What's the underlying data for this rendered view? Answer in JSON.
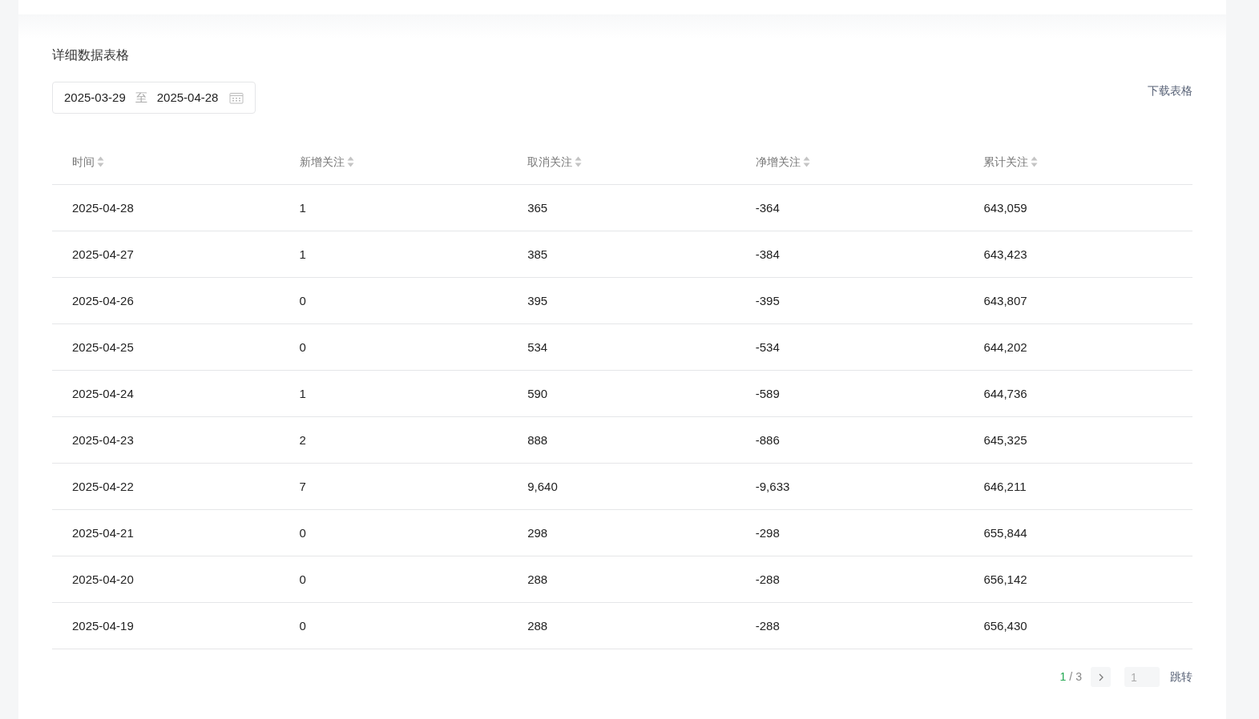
{
  "section_title": "详细数据表格",
  "date_range": {
    "start": "2025-03-29",
    "separator": "至",
    "end": "2025-04-28"
  },
  "download_link": "下载表格",
  "table": {
    "columns": [
      {
        "label": "时间",
        "sortable": true
      },
      {
        "label": "新增关注",
        "sortable": true
      },
      {
        "label": "取消关注",
        "sortable": true
      },
      {
        "label": "净增关注",
        "sortable": true
      },
      {
        "label": "累计关注",
        "sortable": true
      }
    ],
    "rows": [
      [
        "2025-04-28",
        "1",
        "365",
        "-364",
        "643,059"
      ],
      [
        "2025-04-27",
        "1",
        "385",
        "-384",
        "643,423"
      ],
      [
        "2025-04-26",
        "0",
        "395",
        "-395",
        "643,807"
      ],
      [
        "2025-04-25",
        "0",
        "534",
        "-534",
        "644,202"
      ],
      [
        "2025-04-24",
        "1",
        "590",
        "-589",
        "644,736"
      ],
      [
        "2025-04-23",
        "2",
        "888",
        "-886",
        "645,325"
      ],
      [
        "2025-04-22",
        "7",
        "9,640",
        "-9,633",
        "646,211"
      ],
      [
        "2025-04-21",
        "0",
        "298",
        "-298",
        "655,844"
      ],
      [
        "2025-04-20",
        "0",
        "288",
        "-288",
        "656,142"
      ],
      [
        "2025-04-19",
        "0",
        "288",
        "-288",
        "656,430"
      ]
    ]
  },
  "pagination": {
    "current_page": "1",
    "separator": "/",
    "total_pages": "3",
    "page_input_placeholder": "1",
    "jump_button": "跳转"
  }
}
